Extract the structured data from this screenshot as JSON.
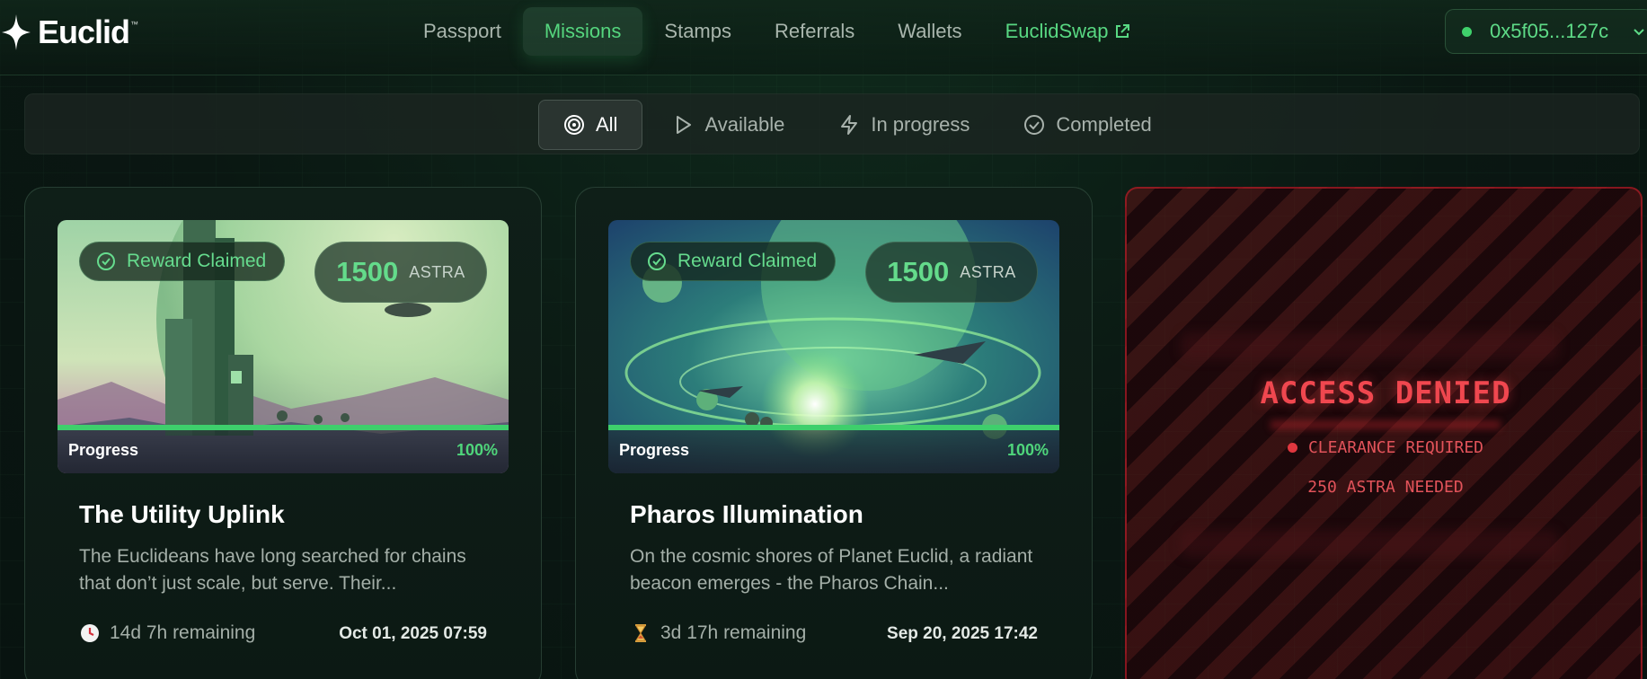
{
  "brand": {
    "name": "Euclid",
    "tm": "™"
  },
  "nav": {
    "items": [
      {
        "label": "Passport"
      },
      {
        "label": "Missions"
      },
      {
        "label": "Stamps"
      },
      {
        "label": "Referrals"
      },
      {
        "label": "Wallets"
      },
      {
        "label": "EuclidSwap"
      }
    ],
    "active": "Missions"
  },
  "wallet": {
    "address": "0x5f05...127c",
    "status_color": "#3fd16b"
  },
  "filters": {
    "items": [
      {
        "label": "All",
        "icon": "target-icon"
      },
      {
        "label": "Available",
        "icon": "play-icon"
      },
      {
        "label": "In progress",
        "icon": "lightning-icon"
      },
      {
        "label": "Completed",
        "icon": "check-circle-icon"
      }
    ],
    "active": "All"
  },
  "missions": [
    {
      "badge": "Reward Claimed",
      "reward_amount": "1500",
      "reward_unit": "ASTRA",
      "progress_label": "Progress",
      "progress_pct": "100%",
      "progress_value": 1.0,
      "title": "The Utility Uplink",
      "description": "The Euclideans have long searched for chains that don’t just scale, but serve. Their...",
      "time_icon": "clock-icon",
      "time_remaining": "14d 7h remaining",
      "date": "Oct 01, 2025 07:59"
    },
    {
      "badge": "Reward Claimed",
      "reward_amount": "1500",
      "reward_unit": "ASTRA",
      "progress_label": "Progress",
      "progress_pct": "100%",
      "progress_value": 1.0,
      "title": "Pharos Illumination",
      "description": "On the cosmic shores of Planet Euclid, a radiant beacon emerges - the Pharos Chain...",
      "time_icon": "hourglass-icon",
      "time_remaining": "3d 17h remaining",
      "date": "Sep 20, 2025 17:42"
    }
  ],
  "locked": {
    "title": "ACCESS DENIED",
    "requirement": "CLEARANCE REQUIRED",
    "needed": "250 ASTRA NEEDED"
  },
  "colors": {
    "accent": "#55d67e",
    "background": "#0a1712",
    "denied": "#f0474f"
  }
}
